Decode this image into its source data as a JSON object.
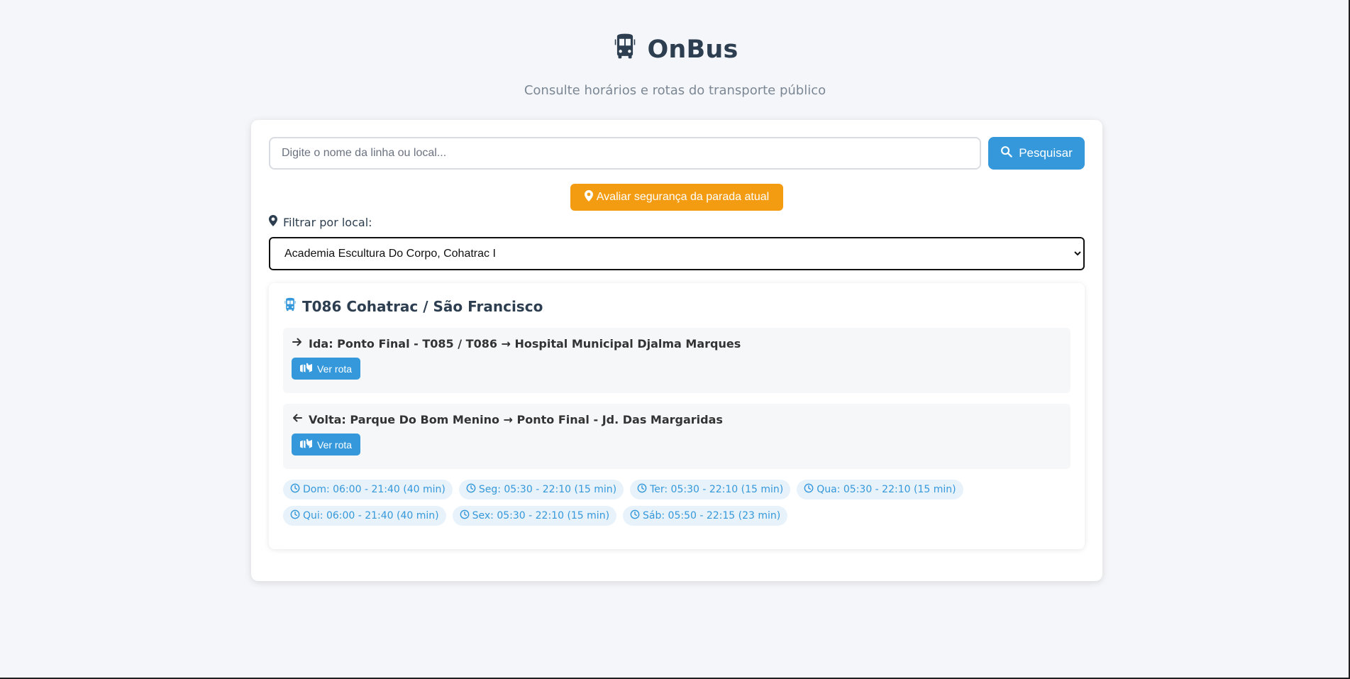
{
  "header": {
    "title": "OnBus",
    "subtitle": "Consulte horários e rotas do transporte público"
  },
  "search": {
    "placeholder": "Digite o nome da linha ou local...",
    "button_label": "Pesquisar"
  },
  "safety_button": "Avaliar segurança da parada atual",
  "filter": {
    "label": "Filtrar por local:",
    "selected": "Academia Escultura Do Corpo, Cohatrac I"
  },
  "route": {
    "title": "T086 Cohatrac / São Francisco",
    "outbound": {
      "text": "Ida: Ponto Final - T085 / T086 → Hospital Municipal Djalma Marques",
      "button": "Ver rota"
    },
    "return": {
      "text": "Volta: Parque Do Bom Menino → Ponto Final - Jd. Das Margaridas",
      "button": "Ver rota"
    },
    "schedules": [
      "Dom: 06:00 - 21:40 (40 min)",
      "Seg: 05:30 - 22:10 (15 min)",
      "Ter: 05:30 - 22:10 (15 min)",
      "Qua: 05:30 - 22:10 (15 min)",
      "Qui: 06:00 - 21:40 (40 min)",
      "Sex: 05:30 - 22:10 (15 min)",
      "Sáb: 05:50 - 22:15 (23 min)"
    ]
  },
  "colors": {
    "primary": "#3498db",
    "warning": "#f39c12",
    "text": "#2c3e50",
    "background": "#f5f6f9"
  }
}
